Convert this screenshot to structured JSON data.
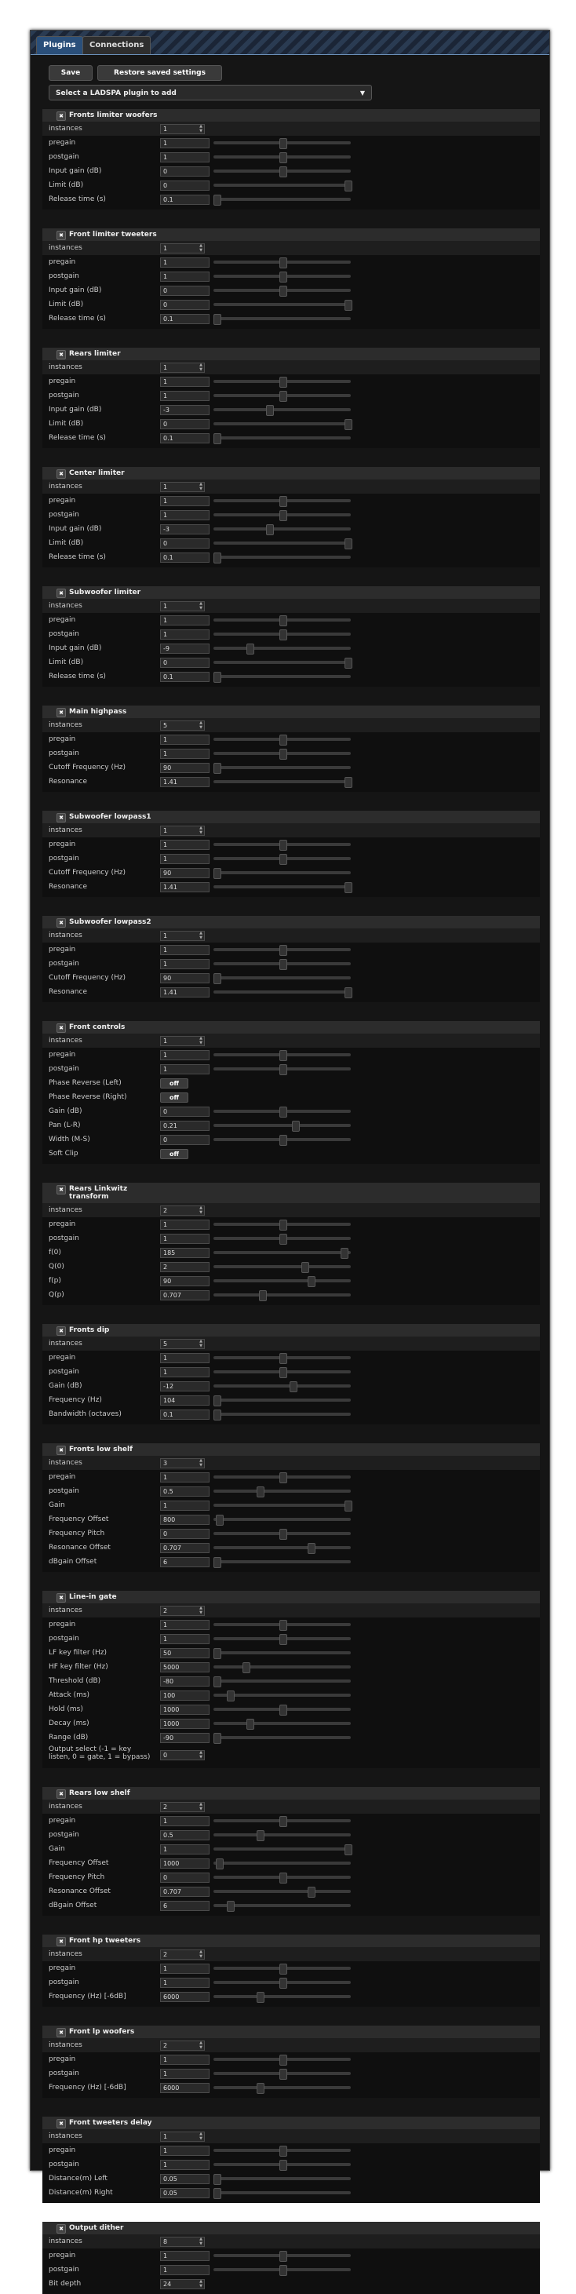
{
  "tabs": [
    {
      "label": "Plugins"
    },
    {
      "label": "Connections"
    }
  ],
  "toolbar": {
    "save_label": "Save",
    "restore_label": "Restore saved settings"
  },
  "plugin_select": {
    "label": "Select a LADSPA plugin to add"
  },
  "plugins": [
    {
      "title": [
        "Fronts limiter woofers"
      ],
      "params": [
        {
          "label": "instances",
          "value": "1",
          "type": "spin"
        },
        {
          "label": "pregain",
          "value": "1",
          "type": "slider",
          "level": 0.5
        },
        {
          "label": "postgain",
          "value": "1",
          "type": "slider",
          "level": 0.5
        },
        {
          "label": "Input gain (dB)",
          "value": "0",
          "type": "slider",
          "level": 0.5
        },
        {
          "label": "Limit (dB)",
          "value": "0",
          "type": "slider",
          "level": 1.0
        },
        {
          "label": "Release time (s)",
          "value": "0.1",
          "type": "slider",
          "level": 0.0
        }
      ]
    },
    {
      "title": [
        "Front limiter tweeters"
      ],
      "params": [
        {
          "label": "instances",
          "value": "1",
          "type": "spin"
        },
        {
          "label": "pregain",
          "value": "1",
          "type": "slider",
          "level": 0.5
        },
        {
          "label": "postgain",
          "value": "1",
          "type": "slider",
          "level": 0.5
        },
        {
          "label": "Input gain (dB)",
          "value": "0",
          "type": "slider",
          "level": 0.5
        },
        {
          "label": "Limit (dB)",
          "value": "0",
          "type": "slider",
          "level": 1.0
        },
        {
          "label": "Release time (s)",
          "value": "0.1",
          "type": "slider",
          "level": 0.0
        }
      ]
    },
    {
      "title": [
        "Rears limiter"
      ],
      "params": [
        {
          "label": "instances",
          "value": "1",
          "type": "spin"
        },
        {
          "label": "pregain",
          "value": "1",
          "type": "slider",
          "level": 0.5
        },
        {
          "label": "postgain",
          "value": "1",
          "type": "slider",
          "level": 0.5
        },
        {
          "label": "Input gain (dB)",
          "value": "-3",
          "type": "slider",
          "level": 0.4
        },
        {
          "label": "Limit (dB)",
          "value": "0",
          "type": "slider",
          "level": 1.0
        },
        {
          "label": "Release time (s)",
          "value": "0.1",
          "type": "slider",
          "level": 0.0
        }
      ]
    },
    {
      "title": [
        "Center limiter"
      ],
      "params": [
        {
          "label": "instances",
          "value": "1",
          "type": "spin"
        },
        {
          "label": "pregain",
          "value": "1",
          "type": "slider",
          "level": 0.5
        },
        {
          "label": "postgain",
          "value": "1",
          "type": "slider",
          "level": 0.5
        },
        {
          "label": "Input gain (dB)",
          "value": "-3",
          "type": "slider",
          "level": 0.4
        },
        {
          "label": "Limit (dB)",
          "value": "0",
          "type": "slider",
          "level": 1.0
        },
        {
          "label": "Release time (s)",
          "value": "0.1",
          "type": "slider",
          "level": 0.0
        }
      ]
    },
    {
      "title": [
        "Subwoofer limiter"
      ],
      "params": [
        {
          "label": "instances",
          "value": "1",
          "type": "spin"
        },
        {
          "label": "pregain",
          "value": "1",
          "type": "slider",
          "level": 0.5
        },
        {
          "label": "postgain",
          "value": "1",
          "type": "slider",
          "level": 0.5
        },
        {
          "label": "Input gain (dB)",
          "value": "-9",
          "type": "slider",
          "level": 0.25
        },
        {
          "label": "Limit (dB)",
          "value": "0",
          "type": "slider",
          "level": 1.0
        },
        {
          "label": "Release time (s)",
          "value": "0.1",
          "type": "slider",
          "level": 0.0
        }
      ]
    },
    {
      "title": [
        "Main highpass"
      ],
      "params": [
        {
          "label": "instances",
          "value": "5",
          "type": "spin"
        },
        {
          "label": "pregain",
          "value": "1",
          "type": "slider",
          "level": 0.5
        },
        {
          "label": "postgain",
          "value": "1",
          "type": "slider",
          "level": 0.5
        },
        {
          "label": "Cutoff Frequency (Hz)",
          "value": "90",
          "type": "slider",
          "level": 0.0
        },
        {
          "label": "Resonance",
          "value": "1.41",
          "type": "slider",
          "level": 1.0
        }
      ]
    },
    {
      "title": [
        "Subwoofer lowpass1"
      ],
      "params": [
        {
          "label": "instances",
          "value": "1",
          "type": "spin"
        },
        {
          "label": "pregain",
          "value": "1",
          "type": "slider",
          "level": 0.5
        },
        {
          "label": "postgain",
          "value": "1",
          "type": "slider",
          "level": 0.5
        },
        {
          "label": "Cutoff Frequency (Hz)",
          "value": "90",
          "type": "slider",
          "level": 0.0
        },
        {
          "label": "Resonance",
          "value": "1.41",
          "type": "slider",
          "level": 1.0
        }
      ]
    },
    {
      "title": [
        "Subwoofer lowpass2"
      ],
      "params": [
        {
          "label": "instances",
          "value": "1",
          "type": "spin"
        },
        {
          "label": "pregain",
          "value": "1",
          "type": "slider",
          "level": 0.5
        },
        {
          "label": "postgain",
          "value": "1",
          "type": "slider",
          "level": 0.5
        },
        {
          "label": "Cutoff Frequency (Hz)",
          "value": "90",
          "type": "slider",
          "level": 0.0
        },
        {
          "label": "Resonance",
          "value": "1.41",
          "type": "slider",
          "level": 1.0
        }
      ]
    },
    {
      "title": [
        "Front controls"
      ],
      "params": [
        {
          "label": "instances",
          "value": "1",
          "type": "spin"
        },
        {
          "label": "pregain",
          "value": "1",
          "type": "slider",
          "level": 0.5
        },
        {
          "label": "postgain",
          "value": "1",
          "type": "slider",
          "level": 0.5
        },
        {
          "label": "Phase Reverse (Left)",
          "value": "off",
          "type": "toggle"
        },
        {
          "label": "Phase Reverse (Right)",
          "value": "off",
          "type": "toggle"
        },
        {
          "label": "Gain (dB)",
          "value": "0",
          "type": "slider",
          "level": 0.5
        },
        {
          "label": "Pan (L-R)",
          "value": "0.21",
          "type": "slider",
          "level": 0.6
        },
        {
          "label": "Width (M-S)",
          "value": "0",
          "type": "slider",
          "level": 0.5
        },
        {
          "label": "Soft Clip",
          "value": "off",
          "type": "toggle"
        }
      ]
    },
    {
      "title": [
        "Rears Linkwitz",
        "transform"
      ],
      "params": [
        {
          "label": "instances",
          "value": "2",
          "type": "spin"
        },
        {
          "label": "pregain",
          "value": "1",
          "type": "slider",
          "level": 0.5
        },
        {
          "label": "postgain",
          "value": "1",
          "type": "slider",
          "level": 0.5
        },
        {
          "label": "f(0)",
          "value": "185",
          "type": "slider",
          "level": 0.97
        },
        {
          "label": "Q(0)",
          "value": "2",
          "type": "slider",
          "level": 0.67
        },
        {
          "label": "f(p)",
          "value": "90",
          "type": "slider",
          "level": 0.72
        },
        {
          "label": "Q(p)",
          "value": "0.707",
          "type": "slider",
          "level": 0.35
        }
      ]
    },
    {
      "title": [
        "Fronts dip"
      ],
      "params": [
        {
          "label": "instances",
          "value": "5",
          "type": "spin"
        },
        {
          "label": "pregain",
          "value": "1",
          "type": "slider",
          "level": 0.5
        },
        {
          "label": "postgain",
          "value": "1",
          "type": "slider",
          "level": 0.5
        },
        {
          "label": "Gain (dB)",
          "value": "-12",
          "type": "slider",
          "level": 0.58
        },
        {
          "label": "Frequency (Hz)",
          "value": "104",
          "type": "slider",
          "level": 0.0
        },
        {
          "label": "Bandwidth (octaves)",
          "value": "0.1",
          "type": "slider",
          "level": 0.0
        }
      ]
    },
    {
      "title": [
        "Fronts low shelf"
      ],
      "params": [
        {
          "label": "instances",
          "value": "3",
          "type": "spin"
        },
        {
          "label": "pregain",
          "value": "1",
          "type": "slider",
          "level": 0.5
        },
        {
          "label": "postgain",
          "value": "0.5",
          "type": "slider",
          "level": 0.33
        },
        {
          "label": "Gain",
          "value": "1",
          "type": "slider",
          "level": 1.0
        },
        {
          "label": "Frequency Offset",
          "value": "800",
          "type": "slider",
          "level": 0.02
        },
        {
          "label": "Frequency Pitch",
          "value": "0",
          "type": "slider",
          "level": 0.5
        },
        {
          "label": "Resonance Offset",
          "value": "0.707",
          "type": "slider",
          "level": 0.72
        },
        {
          "label": "dBgain Offset",
          "value": "6",
          "type": "slider",
          "level": 0.0
        }
      ]
    },
    {
      "title": [
        "Line-in gate"
      ],
      "params": [
        {
          "label": "instances",
          "value": "2",
          "type": "spin"
        },
        {
          "label": "pregain",
          "value": "1",
          "type": "slider",
          "level": 0.5
        },
        {
          "label": "postgain",
          "value": "1",
          "type": "slider",
          "level": 0.5
        },
        {
          "label": "LF key filter (Hz)",
          "value": "50",
          "type": "slider",
          "level": 0.0
        },
        {
          "label": "HF key filter (Hz)",
          "value": "5000",
          "type": "slider",
          "level": 0.22
        },
        {
          "label": "Threshold (dB)",
          "value": "-80",
          "type": "slider",
          "level": 0.0
        },
        {
          "label": "Attack (ms)",
          "value": "100",
          "type": "slider",
          "level": 0.1
        },
        {
          "label": "Hold (ms)",
          "value": "1000",
          "type": "slider",
          "level": 0.5
        },
        {
          "label": "Decay (ms)",
          "value": "1000",
          "type": "slider",
          "level": 0.25
        },
        {
          "label": "Range (dB)",
          "value": "-90",
          "type": "slider",
          "level": 0.0
        },
        {
          "label": "Output select (-1 = key listen, 0 = gate, 1 = bypass)",
          "value": "0",
          "type": "spin",
          "tall": true
        }
      ]
    },
    {
      "title": [
        "Rears low shelf"
      ],
      "params": [
        {
          "label": "instances",
          "value": "2",
          "type": "spin"
        },
        {
          "label": "pregain",
          "value": "1",
          "type": "slider",
          "level": 0.5
        },
        {
          "label": "postgain",
          "value": "0.5",
          "type": "slider",
          "level": 0.33
        },
        {
          "label": "Gain",
          "value": "1",
          "type": "slider",
          "level": 1.0
        },
        {
          "label": "Frequency Offset",
          "value": "1000",
          "type": "slider",
          "level": 0.02
        },
        {
          "label": "Frequency Pitch",
          "value": "0",
          "type": "slider",
          "level": 0.5
        },
        {
          "label": "Resonance Offset",
          "value": "0.707",
          "type": "slider",
          "level": 0.72
        },
        {
          "label": "dBgain Offset",
          "value": "6",
          "type": "slider",
          "level": 0.1
        }
      ]
    },
    {
      "title": [
        "Front hp tweeters"
      ],
      "params": [
        {
          "label": "instances",
          "value": "2",
          "type": "spin"
        },
        {
          "label": "pregain",
          "value": "1",
          "type": "slider",
          "level": 0.5
        },
        {
          "label": "postgain",
          "value": "1",
          "type": "slider",
          "level": 0.5
        },
        {
          "label": "Frequency (Hz) [-6dB]",
          "value": "6000",
          "type": "slider",
          "level": 0.33
        }
      ]
    },
    {
      "title": [
        "Front lp woofers"
      ],
      "params": [
        {
          "label": "instances",
          "value": "2",
          "type": "spin"
        },
        {
          "label": "pregain",
          "value": "1",
          "type": "slider",
          "level": 0.5
        },
        {
          "label": "postgain",
          "value": "1",
          "type": "slider",
          "level": 0.5
        },
        {
          "label": "Frequency (Hz) [-6dB]",
          "value": "6000",
          "type": "slider",
          "level": 0.33
        }
      ]
    },
    {
      "title": [
        "Front tweeters delay"
      ],
      "params": [
        {
          "label": "instances",
          "value": "1",
          "type": "spin"
        },
        {
          "label": "pregain",
          "value": "1",
          "type": "slider",
          "level": 0.5
        },
        {
          "label": "postgain",
          "value": "1",
          "type": "slider",
          "level": 0.5
        },
        {
          "label": "Distance(m) Left",
          "value": "0.05",
          "type": "slider",
          "level": 0.0
        },
        {
          "label": "Distance(m) Right",
          "value": "0.05",
          "type": "slider",
          "level": 0.0
        }
      ]
    },
    {
      "title": [
        "Output dither"
      ],
      "params": [
        {
          "label": "instances",
          "value": "8",
          "type": "spin"
        },
        {
          "label": "pregain",
          "value": "1",
          "type": "slider",
          "level": 0.5
        },
        {
          "label": "postgain",
          "value": "1",
          "type": "slider",
          "level": 0.5
        },
        {
          "label": "Bit depth",
          "value": "24",
          "type": "spin"
        }
      ]
    }
  ]
}
